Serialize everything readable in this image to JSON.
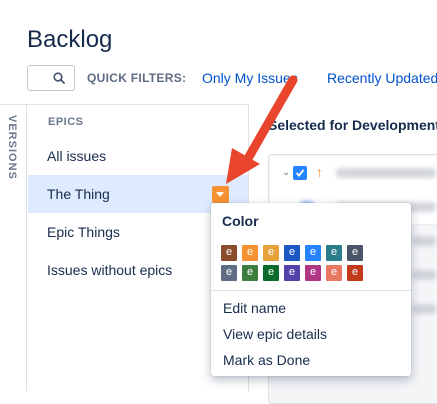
{
  "page": {
    "title": "Backlog"
  },
  "toolbar": {
    "search_icon": "search-icon",
    "quick_filters_label": "QUICK FILTERS:",
    "quick_filters": [
      "Only My Issues",
      "Recently Updated"
    ]
  },
  "side": {
    "versions_label": "VERSIONS"
  },
  "epics": {
    "heading": "EPICS",
    "items": [
      "All issues",
      "The Thing",
      "Epic Things",
      "Issues without epics"
    ],
    "selected_index": 1,
    "selected_color": "#f79232"
  },
  "sprint": {
    "title": "Selected for Development",
    "row_icons": [
      "chevron-down-icon",
      "checkbox-checked-icon",
      "priority-arrow-up-icon"
    ]
  },
  "color_popup": {
    "title": "Color",
    "swatch_letter": "e",
    "swatches": [
      [
        "#8b4b2d",
        "#f79232",
        "#e8a23c",
        "#1d59c4",
        "#2684ff",
        "#2c7d8c",
        "#4a5568"
      ],
      [
        "#5e6c84",
        "#3d7d3d",
        "#0b6b2d",
        "#5243aa",
        "#b03582",
        "#e87860",
        "#c2391b"
      ]
    ],
    "menu_items": [
      "Edit name",
      "View epic details",
      "Mark as Done"
    ]
  },
  "colors": {
    "annotation_arrow": "#e8452c",
    "link": "#0052cc",
    "selected_bg": "#deebff"
  }
}
